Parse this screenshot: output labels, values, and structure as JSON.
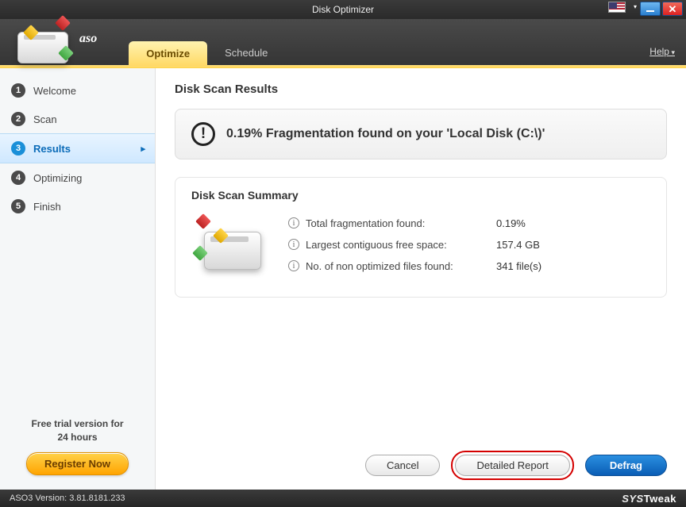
{
  "window": {
    "title": "Disk Optimizer"
  },
  "header": {
    "brand": "aso",
    "tabs": [
      {
        "label": "Optimize",
        "active": true
      },
      {
        "label": "Schedule",
        "active": false
      }
    ],
    "help": "Help"
  },
  "sidebar": {
    "steps": [
      {
        "num": "1",
        "label": "Welcome"
      },
      {
        "num": "2",
        "label": "Scan"
      },
      {
        "num": "3",
        "label": "Results"
      },
      {
        "num": "4",
        "label": "Optimizing"
      },
      {
        "num": "5",
        "label": "Finish"
      }
    ],
    "active_index": 2,
    "trial_line1": "Free trial version for",
    "trial_line2": "24 hours",
    "register": "Register Now"
  },
  "main": {
    "heading": "Disk Scan Results",
    "alert": "0.19% Fragmentation found on your 'Local Disk (C:\\)'",
    "summary_heading": "Disk Scan Summary",
    "rows": [
      {
        "label": "Total fragmentation found:",
        "value": "0.19%"
      },
      {
        "label": "Largest contiguous free space:",
        "value": "157.4 GB"
      },
      {
        "label": "No. of non optimized files found:",
        "value": "341 file(s)"
      }
    ],
    "buttons": {
      "cancel": "Cancel",
      "detailed": "Detailed Report",
      "defrag": "Defrag"
    }
  },
  "status": {
    "version": "ASO3 Version: 3.81.8181.233",
    "brand_a": "SYS",
    "brand_b": "Tweak"
  }
}
